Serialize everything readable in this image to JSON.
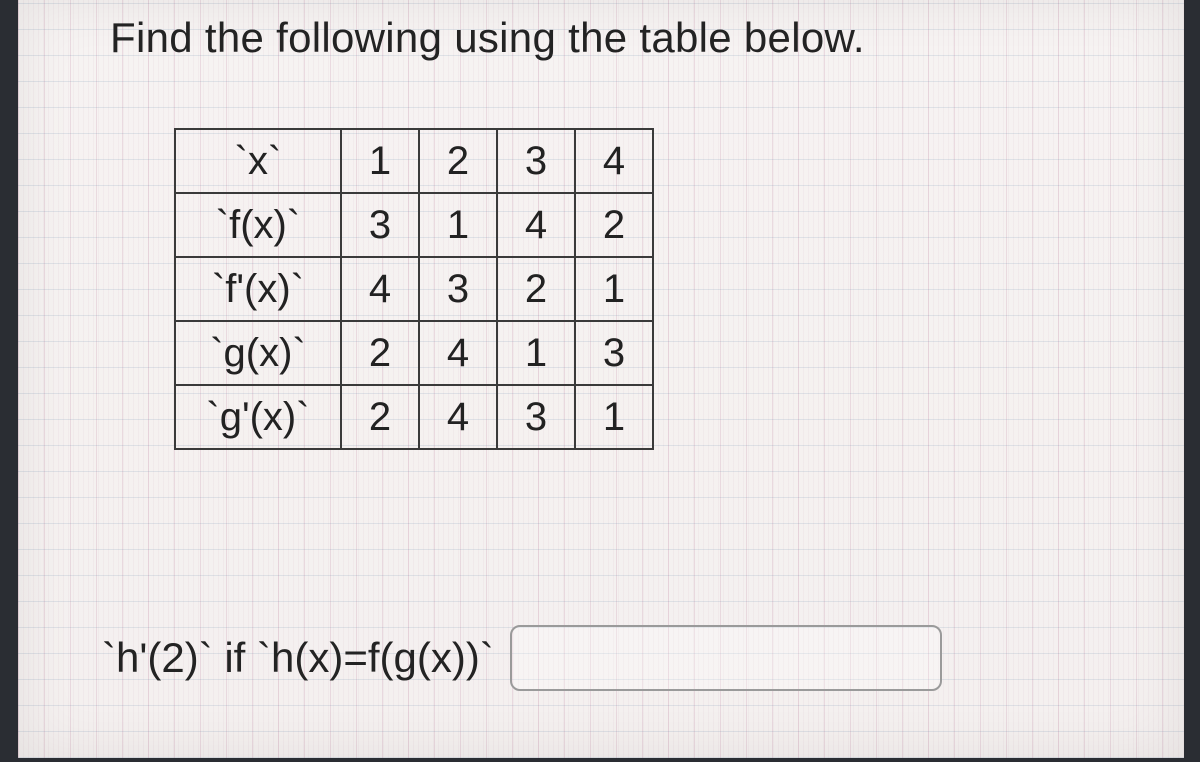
{
  "prompt": "Find the following using the table below.",
  "table": {
    "header": {
      "label": "`x`",
      "cols": [
        "1",
        "2",
        "3",
        "4"
      ]
    },
    "rows": [
      {
        "label": "`f(x)`",
        "vals": [
          "3",
          "1",
          "4",
          "2"
        ]
      },
      {
        "label": "`f'(x)`",
        "vals": [
          "4",
          "3",
          "2",
          "1"
        ]
      },
      {
        "label": "`g(x)`",
        "vals": [
          "2",
          "4",
          "1",
          "3"
        ]
      },
      {
        "label": "`g'(x)`",
        "vals": [
          "2",
          "4",
          "3",
          "1"
        ]
      }
    ]
  },
  "question": "`h'(2)` if `h(x)=f(g(x))`",
  "answer_placeholder": ""
}
